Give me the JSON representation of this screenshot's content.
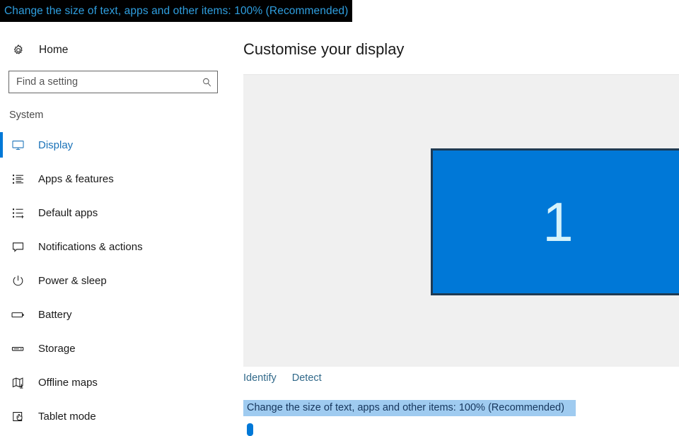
{
  "tooltip_banner": {
    "text": "Change the size of text, apps and other items: 100% (Recommended)"
  },
  "sidebar": {
    "home": {
      "label": "Home",
      "icon": "gear-icon"
    },
    "search": {
      "placeholder": "Find a setting",
      "value": "",
      "icon": "search-icon"
    },
    "section_label": "System",
    "items": [
      {
        "label": "Display",
        "icon": "monitor-icon",
        "selected": true
      },
      {
        "label": "Apps & features",
        "icon": "list-icon",
        "selected": false
      },
      {
        "label": "Default apps",
        "icon": "list-plus-icon",
        "selected": false
      },
      {
        "label": "Notifications & actions",
        "icon": "speech-bubble-icon",
        "selected": false
      },
      {
        "label": "Power & sleep",
        "icon": "power-icon",
        "selected": false
      },
      {
        "label": "Battery",
        "icon": "battery-icon",
        "selected": false
      },
      {
        "label": "Storage",
        "icon": "drive-icon",
        "selected": false
      },
      {
        "label": "Offline maps",
        "icon": "map-download-icon",
        "selected": false
      },
      {
        "label": "Tablet mode",
        "icon": "tablet-hand-icon",
        "selected": false
      }
    ]
  },
  "main": {
    "title": "Customise your display",
    "monitor": {
      "number": "1"
    },
    "links": [
      {
        "label": "Identify"
      },
      {
        "label": "Detect"
      }
    ],
    "scale_setting": {
      "label": "Change the size of text, apps and other items: 100% (Recommended)",
      "value_percent": "100%"
    }
  },
  "colors": {
    "accent": "#0078d7",
    "selected_text": "#1a72b8",
    "link": "#31698a",
    "highlight_bg": "#9fcbf0",
    "banner_bg": "#000000",
    "banner_text": "#2f9fe0",
    "preview_bg": "#f0f0f0",
    "monitor_border": "#1f3a52"
  }
}
